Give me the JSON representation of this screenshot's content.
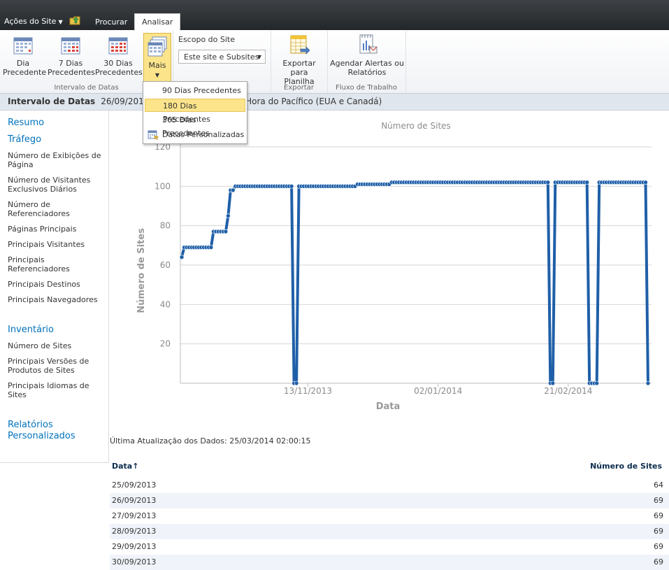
{
  "topbar": {
    "site_actions": "Ações do Site",
    "tabs": [
      "Procurar",
      "Analisar"
    ]
  },
  "ribbon": {
    "groups": [
      {
        "label": "Intervalo de Datas",
        "buttons": [
          {
            "line1": "Dia",
            "line2": "Precedente"
          },
          {
            "line1": "7 Dias",
            "line2": "Precedentes"
          },
          {
            "line1": "30 Dias",
            "line2": "Precedentes"
          },
          {
            "line1": "Mais",
            "line2": ""
          }
        ]
      },
      {
        "label": "",
        "escopo_label": "Escopo do Site",
        "escopo_value": "Este site e Subsites"
      },
      {
        "label": "Exportar",
        "button": {
          "line1": "Exportar para",
          "line2": "Planilha"
        }
      },
      {
        "label": "Fluxo de Trabalho",
        "button": {
          "line1": "Agendar Alertas ou",
          "line2": "Relatórios"
        }
      }
    ]
  },
  "dropdown": {
    "items": [
      "90 Dias Precedentes",
      "180 Dias Precedentes",
      "365 Dias Precedentes",
      "Datas Personalizadas"
    ],
    "selected_index": 1
  },
  "date_range": {
    "label": "Intervalo de Datas",
    "left_text": "26/09/2013",
    "right_text": "0) Hora do Pacífico (EUA e Canadá)"
  },
  "sidebar": {
    "resumo": "Resumo",
    "trafego": "Tráfego",
    "traffic_links": [
      "Número de Exibições de Página",
      "Número de Visitantes Exclusivos Diários",
      "Número de Referenciadores",
      "Páginas Principais",
      "Principais Visitantes",
      "Principais Referenciadores",
      "Principais Destinos",
      "Principais Navegadores"
    ],
    "inventario": "Inventário",
    "inventory_links": [
      "Número de Sites",
      "Principais Versões de Produtos de Sites",
      "Principais Idiomas de Sites"
    ],
    "relatorios": "Relatórios Personalizados"
  },
  "chart_data": {
    "type": "line",
    "title": "Número de Sites",
    "xlabel": "Data",
    "ylabel": "Número de Sites",
    "ylim": [
      0,
      120
    ],
    "yticks": [
      20,
      40,
      60,
      80,
      100,
      120
    ],
    "xticks": [
      "13/11/2013",
      "02/01/2014",
      "21/02/2014"
    ],
    "grid": true,
    "color": "#1f5fa8",
    "x_start": "25/09/2013",
    "x_end": "25/03/2014",
    "series": [
      {
        "name": "Número de Sites",
        "values": [
          64,
          69,
          69,
          69,
          69,
          69,
          69,
          69,
          69,
          69,
          69,
          69,
          69,
          77,
          77,
          77,
          77,
          77,
          77,
          85,
          98,
          98,
          100,
          100,
          100,
          100,
          100,
          100,
          100,
          100,
          100,
          100,
          100,
          100,
          100,
          100,
          100,
          100,
          100,
          100,
          100,
          100,
          100,
          100,
          100,
          100,
          0,
          0,
          100,
          100,
          100,
          100,
          100,
          100,
          100,
          100,
          100,
          100,
          100,
          100,
          100,
          100,
          100,
          100,
          100,
          100,
          100,
          100,
          100,
          100,
          100,
          100,
          101,
          101,
          101,
          101,
          101,
          101,
          101,
          101,
          101,
          101,
          101,
          101,
          101,
          101,
          102,
          102,
          102,
          102,
          102,
          102,
          102,
          102,
          102,
          102,
          102,
          102,
          102,
          102,
          102,
          102,
          102,
          102,
          102,
          102,
          102,
          102,
          102,
          102,
          102,
          102,
          102,
          102,
          102,
          102,
          102,
          102,
          102,
          102,
          102,
          102,
          102,
          102,
          102,
          102,
          102,
          102,
          102,
          102,
          102,
          102,
          102,
          102,
          102,
          102,
          102,
          102,
          102,
          102,
          102,
          102,
          102,
          102,
          102,
          102,
          102,
          102,
          102,
          102,
          102,
          0,
          0,
          102,
          102,
          102,
          102,
          102,
          102,
          102,
          102,
          102,
          102,
          102,
          102,
          102,
          102,
          0,
          0,
          0,
          0,
          102,
          102,
          102,
          102,
          102,
          102,
          102,
          102,
          102,
          102,
          102,
          102,
          102,
          102,
          102,
          102,
          102,
          102,
          102,
          102,
          0
        ]
      }
    ]
  },
  "last_update": "Última Atualização dos Dados: 25/03/2014 02:00:15",
  "table": {
    "col_date": "Data",
    "sort_glyph": "↑",
    "col_count": "Número de Sites",
    "rows": [
      {
        "date": "25/09/2013",
        "count": "64"
      },
      {
        "date": "26/09/2013",
        "count": "69"
      },
      {
        "date": "27/09/2013",
        "count": "69"
      },
      {
        "date": "28/09/2013",
        "count": "69"
      },
      {
        "date": "29/09/2013",
        "count": "69"
      },
      {
        "date": "30/09/2013",
        "count": "69"
      }
    ]
  },
  "icons": {
    "calendar": "calendar-icon",
    "export": "spreadsheet-export-icon",
    "alerts": "alerts-report-icon",
    "custom_dates": "custom-dates-icon",
    "nav_up": "navigate-up-icon"
  }
}
